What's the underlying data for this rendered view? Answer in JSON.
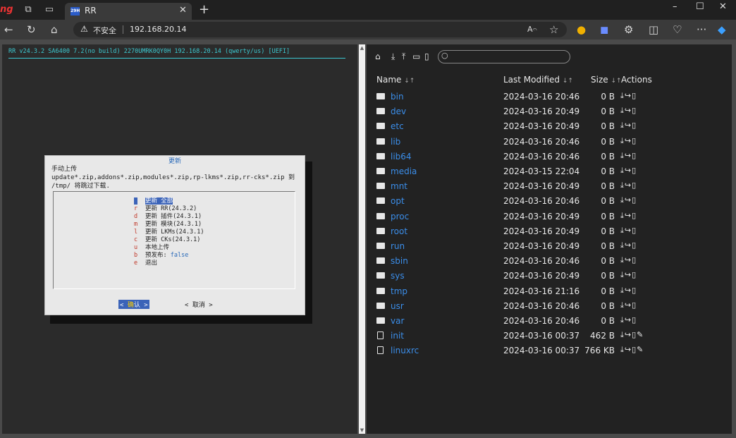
{
  "browser": {
    "tab_title": "RR",
    "tab_favicon_text": "29H",
    "address_warning": "不安全",
    "url": "192.168.20.14"
  },
  "terminal": {
    "header": "RR v24.3.2 SA6400 7.2(no build) 2270UMRK0QY0H 192.168.20.14 (qwerty/us) [UEFI]",
    "dialog": {
      "title": "更新",
      "line1": "手动上传",
      "line2": "update*.zip,addons*.zip,modules*.zip,rp-lkms*.zip,rr-cks*.zip 到",
      "line3": "/tmp/ 将跳过下载.",
      "items": [
        {
          "key": "a",
          "label": "更新 全部"
        },
        {
          "key": "r",
          "label": "更新 RR(24.3.2)"
        },
        {
          "key": "d",
          "label": "更新 插件(24.3.1)"
        },
        {
          "key": "m",
          "label": "更新 模块(24.3.1)"
        },
        {
          "key": "l",
          "label": "更新 LKMs(24.3.1)"
        },
        {
          "key": "c",
          "label": "更新 CKs(24.3.1)"
        },
        {
          "key": "u",
          "label": "本地上传"
        },
        {
          "key": "b",
          "label": "预发布: ",
          "value": "false"
        },
        {
          "key": "e",
          "label": "退出"
        }
      ],
      "ok_prefix": "< ",
      "ok_hot": "确",
      "ok_rest": "认 >",
      "cancel": "< 取消 >"
    }
  },
  "files": {
    "headers": {
      "name": "Name",
      "modified": "Last Modified",
      "size": "Size",
      "actions": "Actions"
    },
    "sort_glyph": "↓↑",
    "rows": [
      {
        "name": "bin",
        "date": "2024-03-16 20:46",
        "size": "0 B",
        "kind": "dir"
      },
      {
        "name": "dev",
        "date": "2024-03-16 20:49",
        "size": "0 B",
        "kind": "dir"
      },
      {
        "name": "etc",
        "date": "2024-03-16 20:49",
        "size": "0 B",
        "kind": "dir"
      },
      {
        "name": "lib",
        "date": "2024-03-16 20:46",
        "size": "0 B",
        "kind": "dir"
      },
      {
        "name": "lib64",
        "date": "2024-03-16 20:46",
        "size": "0 B",
        "kind": "dir"
      },
      {
        "name": "media",
        "date": "2024-03-15 22:04",
        "size": "0 B",
        "kind": "dir"
      },
      {
        "name": "mnt",
        "date": "2024-03-16 20:49",
        "size": "0 B",
        "kind": "dir"
      },
      {
        "name": "opt",
        "date": "2024-03-16 20:46",
        "size": "0 B",
        "kind": "dir"
      },
      {
        "name": "proc",
        "date": "2024-03-16 20:49",
        "size": "0 B",
        "kind": "dir"
      },
      {
        "name": "root",
        "date": "2024-03-16 20:49",
        "size": "0 B",
        "kind": "dir"
      },
      {
        "name": "run",
        "date": "2024-03-16 20:49",
        "size": "0 B",
        "kind": "dir"
      },
      {
        "name": "sbin",
        "date": "2024-03-16 20:46",
        "size": "0 B",
        "kind": "dir"
      },
      {
        "name": "sys",
        "date": "2024-03-16 20:49",
        "size": "0 B",
        "kind": "dir"
      },
      {
        "name": "tmp",
        "date": "2024-03-16 21:16",
        "size": "0 B",
        "kind": "dir"
      },
      {
        "name": "usr",
        "date": "2024-03-16 20:46",
        "size": "0 B",
        "kind": "dir"
      },
      {
        "name": "var",
        "date": "2024-03-16 20:46",
        "size": "0 B",
        "kind": "dir"
      },
      {
        "name": "init",
        "date": "2024-03-16 00:37",
        "size": "462 B",
        "kind": "file"
      },
      {
        "name": "linuxrc",
        "date": "2024-03-16 00:37",
        "size": "766 KB",
        "kind": "file"
      }
    ]
  }
}
